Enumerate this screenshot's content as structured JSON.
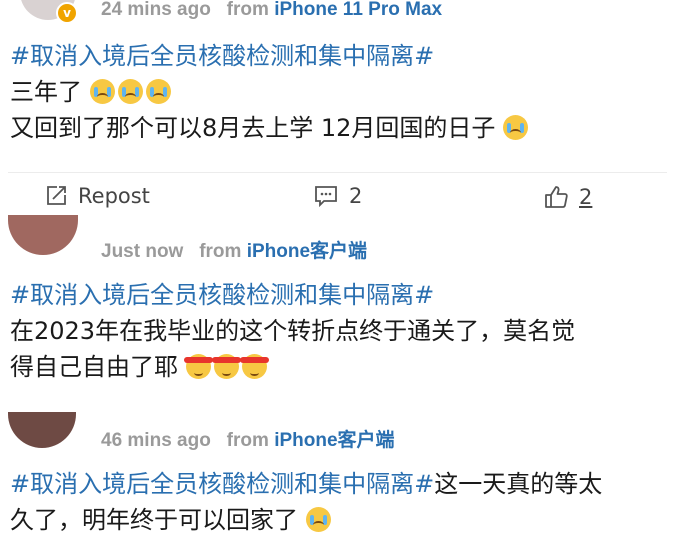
{
  "posts": [
    {
      "time": "24 mins ago",
      "from_prefix": "from",
      "source": "iPhone 11 Pro Max",
      "topic": "#取消入境后全员核酸检测和集中隔离#",
      "lines": [
        "三年了",
        "又回到了那个可以8月去上学 12月回国的日子"
      ],
      "actions": {
        "repost_label": "Repost",
        "comment_count": "2",
        "like_count": "2"
      }
    },
    {
      "time": "Just now",
      "from_prefix": "from",
      "source": "iPhone客户端",
      "topic": "#取消入境后全员核酸检测和集中隔离#",
      "lines": [
        "在2023年在我毕业的这个转折点终于通关了，莫名觉",
        "得自己自由了耶"
      ]
    },
    {
      "time": "46 mins ago",
      "from_prefix": "from",
      "source": "iPhone客户端",
      "topic": "#取消入境后全员核酸检测和集中隔离#",
      "topic_tail": "这一天真的等太",
      "lines": [
        "久了，明年终于可以回家了"
      ]
    }
  ],
  "icons": {
    "verified": "verified-badge-icon",
    "repost": "repost-icon",
    "comment": "comment-icon",
    "like": "thumbs-up-icon",
    "emoji_cry": "crying-face-emoji",
    "emoji_band": "headband-face-emoji"
  },
  "colors": {
    "topic": "#2a6fb0",
    "meta": "#9a9a9a",
    "badge": "#f0a400"
  }
}
